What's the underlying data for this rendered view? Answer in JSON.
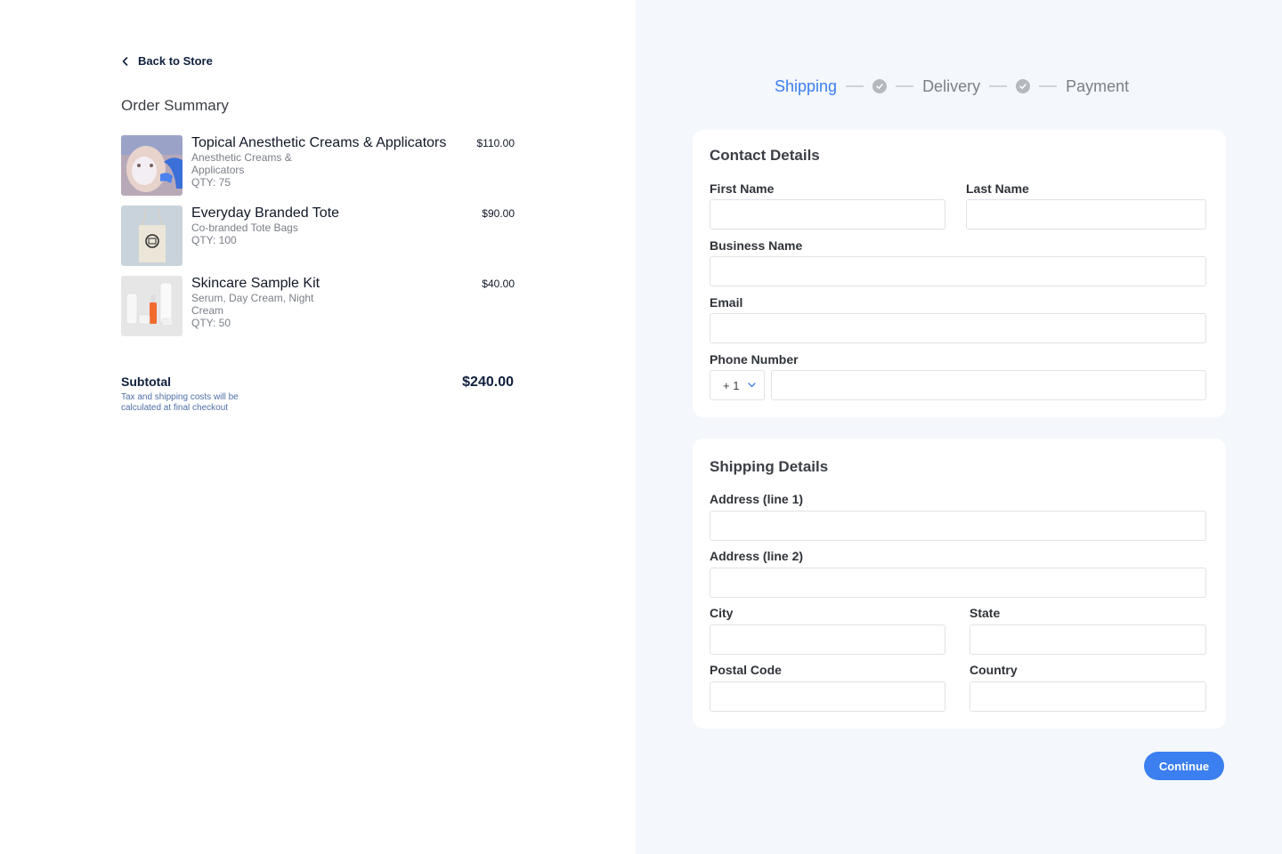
{
  "left": {
    "back_label": "Back to Store",
    "order_title": "Order Summary",
    "items": [
      {
        "name": "Topical Anesthetic Creams & Applicators",
        "subtitle": "Anesthetic Creams & Applicators",
        "qty": "QTY: 75",
        "price": "$110.00"
      },
      {
        "name": "Everyday Branded Tote",
        "subtitle": "Co-branded Tote Bags",
        "qty": "QTY: 100",
        "price": "$90.00"
      },
      {
        "name": "Skincare Sample Kit",
        "subtitle": "Serum, Day Cream, Night Cream",
        "qty": "QTY: 50",
        "price": "$40.00"
      }
    ],
    "subtotal_label": "Subtotal",
    "subtotal_note": "Tax and shipping costs will be calculated at final checkout",
    "subtotal_value": "$240.00"
  },
  "stepper": {
    "steps": [
      "Shipping",
      "Delivery",
      "Payment"
    ],
    "active": "Shipping"
  },
  "contact": {
    "title": "Contact Details",
    "first_name_label": "First Name",
    "last_name_label": "Last Name",
    "business_name_label": "Business Name",
    "email_label": "Email",
    "phone_label": "Phone Number",
    "country_code": "+ 1"
  },
  "shipping": {
    "title": "Shipping Details",
    "address1_label": "Address (line 1)",
    "address2_label": "Address (line 2)",
    "city_label": "City",
    "state_label": "State",
    "postal_label": "Postal Code",
    "country_label": "Country"
  },
  "actions": {
    "continue_label": "Continue"
  },
  "colors": {
    "accent": "#3b7ff0",
    "navy": "#0f1f3d",
    "panel_bg": "#f4f7fc"
  }
}
